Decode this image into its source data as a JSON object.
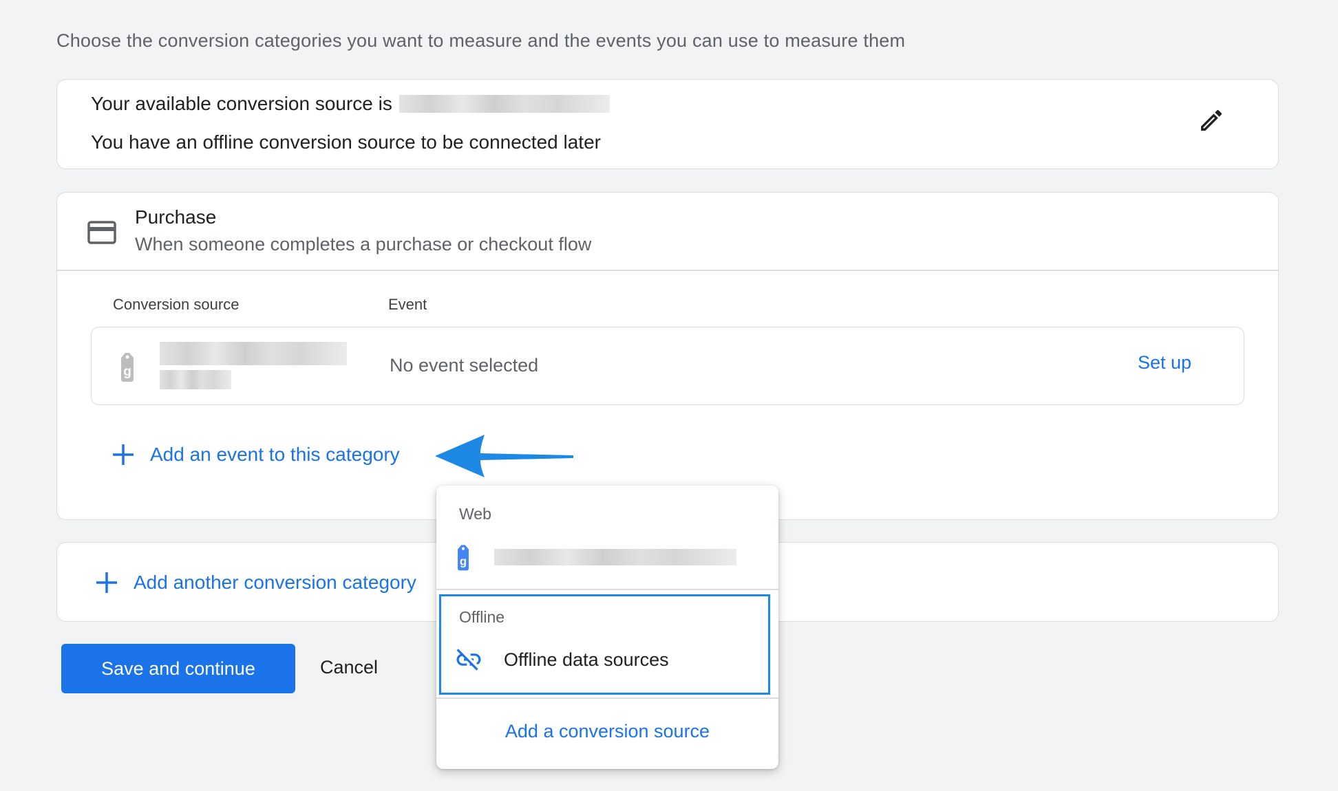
{
  "intro": "Choose the conversion categories you want to measure and the events you can use to measure them",
  "source_summary": {
    "available_label": "Your available conversion source is",
    "offline_note": "You have an offline conversion source to be connected later",
    "edit_icon": "pencil-icon"
  },
  "category": {
    "title": "Purchase",
    "description": "When someone completes a purchase or checkout flow",
    "icon": "credit-card-icon",
    "columns": {
      "source": "Conversion source",
      "event": "Event"
    },
    "row": {
      "event_value": "No event selected",
      "action": "Set up",
      "source_icon": "google-tag-icon"
    },
    "add_event": "Add an event to this category"
  },
  "add_category": "Add another conversion category",
  "buttons": {
    "save": "Save and continue",
    "cancel": "Cancel"
  },
  "menu": {
    "web_header": "Web",
    "offline_header": "Offline",
    "offline_item": "Offline data sources",
    "offline_icon": "link-off-icon",
    "add_source": "Add a conversion source"
  },
  "colors": {
    "accent": "#1a73e8",
    "highlight": "#1a8ae8",
    "callout_arrow": "#1e88e5"
  }
}
